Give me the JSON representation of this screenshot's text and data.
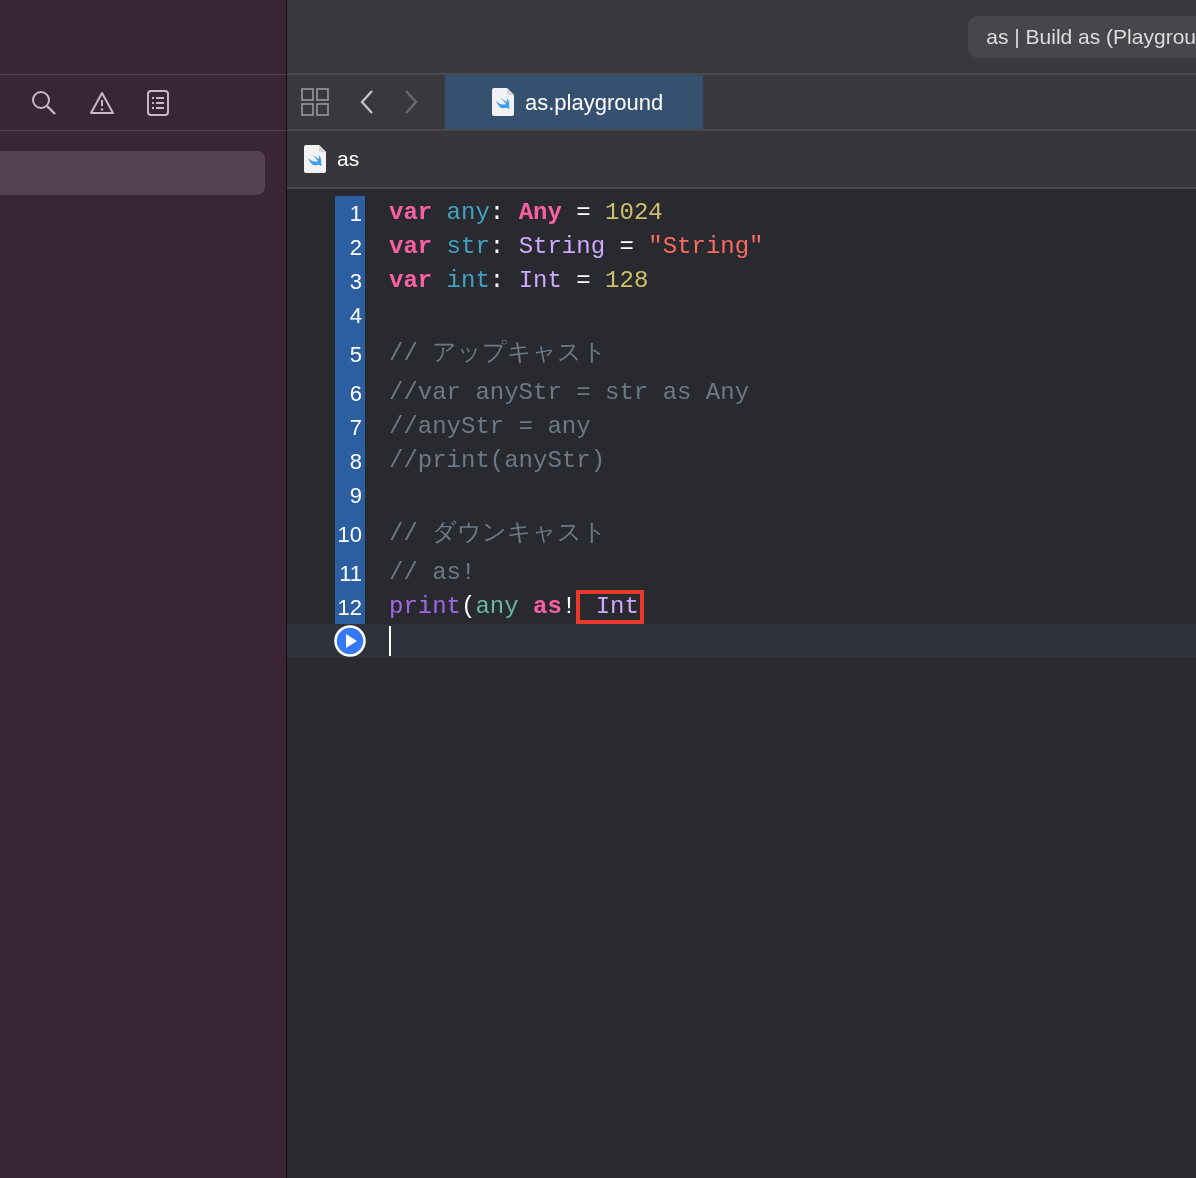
{
  "toolbar": {
    "status": "as | Build as (Playgrou"
  },
  "navigator": {
    "selected_row": true
  },
  "tab_bar": {
    "back_enabled": true,
    "forward_enabled": false,
    "tabs": [
      {
        "label": "as.playground",
        "selected": true
      }
    ]
  },
  "breadcrumb": {
    "label": "as"
  },
  "editor": {
    "lines": [
      {
        "number": "1",
        "tokens": [
          {
            "text": "var",
            "kind": "keyword"
          },
          {
            "text": " any",
            "kind": "declaration"
          },
          {
            "text": ": ",
            "kind": "plain"
          },
          {
            "text": "Any",
            "kind": "keyword"
          },
          {
            "text": " = ",
            "kind": "plain"
          },
          {
            "text": "1024",
            "kind": "number"
          }
        ]
      },
      {
        "number": "2",
        "tokens": [
          {
            "text": "var",
            "kind": "keyword"
          },
          {
            "text": " str",
            "kind": "declaration"
          },
          {
            "text": ": ",
            "kind": "plain"
          },
          {
            "text": "String",
            "kind": "type"
          },
          {
            "text": " = ",
            "kind": "plain"
          },
          {
            "text": "\"String\"",
            "kind": "string"
          }
        ]
      },
      {
        "number": "3",
        "tokens": [
          {
            "text": "var",
            "kind": "keyword"
          },
          {
            "text": " int",
            "kind": "declaration"
          },
          {
            "text": ": ",
            "kind": "plain"
          },
          {
            "text": "Int",
            "kind": "type"
          },
          {
            "text": " = ",
            "kind": "plain"
          },
          {
            "text": "128",
            "kind": "number"
          }
        ]
      },
      {
        "number": "4"
      },
      {
        "number": "5",
        "tokens": [
          {
            "text": "// アップキャスト",
            "kind": "comment"
          }
        ]
      },
      {
        "number": "6",
        "tokens": [
          {
            "text": "//var anyStr = str as Any",
            "kind": "comment"
          }
        ]
      },
      {
        "number": "7",
        "tokens": [
          {
            "text": "//anyStr = any",
            "kind": "comment"
          }
        ]
      },
      {
        "number": "8",
        "tokens": [
          {
            "text": "//print(anyStr)",
            "kind": "comment"
          }
        ]
      },
      {
        "number": "9"
      },
      {
        "number": "10",
        "tokens": [
          {
            "text": "// ダウンキャスト",
            "kind": "comment"
          }
        ]
      },
      {
        "number": "11",
        "tokens": [
          {
            "text": "// as!",
            "kind": "comment"
          }
        ]
      },
      {
        "number": "12",
        "tokens": [
          {
            "text": "print",
            "kind": "function"
          },
          {
            "text": "(",
            "kind": "plain"
          },
          {
            "text": "any",
            "kind": "reference"
          },
          {
            "text": " as",
            "kind": "keyword"
          },
          {
            "text": "!",
            "kind": "plain"
          },
          {
            "text": " Int",
            "kind": "type",
            "boxed": true
          }
        ]
      }
    ]
  }
}
